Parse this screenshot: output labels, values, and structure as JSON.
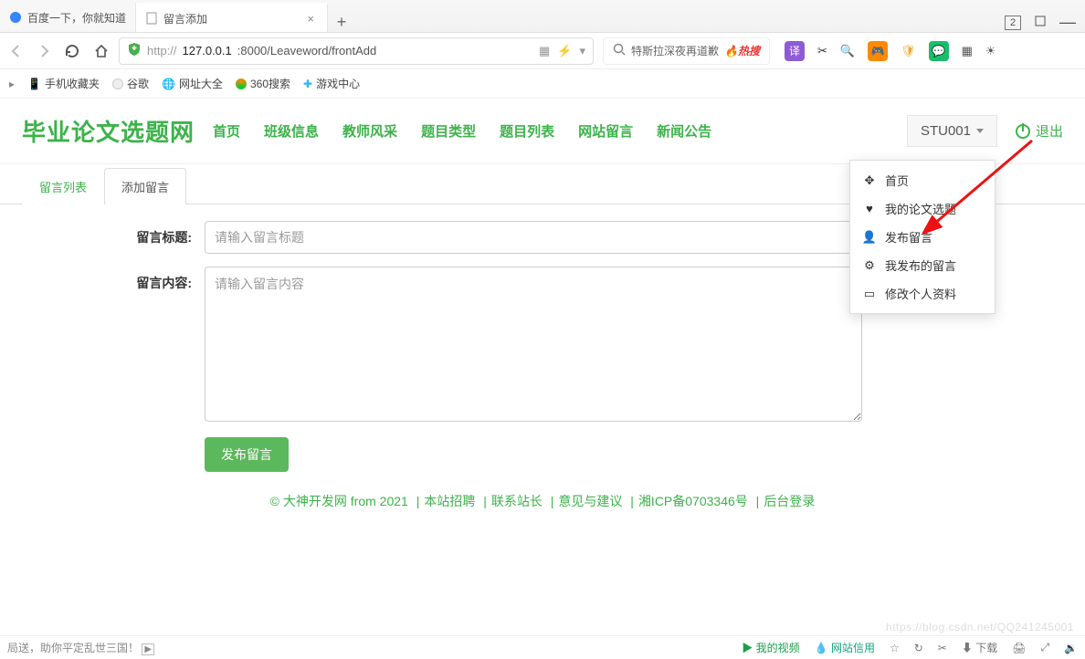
{
  "browser": {
    "tabs": [
      {
        "title": "百度一下，你就知道",
        "favicon_color": "#3385ff"
      },
      {
        "title": "留言添加",
        "favicon_color": "#888"
      }
    ],
    "newtab": "+",
    "window_counter": "2",
    "url_scheme": "http://",
    "url_host": "127.0.0.1",
    "url_port_path": ":8000/Leaveword/frontAdd",
    "hotsearch_text": "特斯拉深夜再道歉",
    "hotsearch_badge": "热搜",
    "bookmarks": [
      "手机收藏夹",
      "谷歌",
      "网址大全",
      "360搜索",
      "游戏中心"
    ]
  },
  "site": {
    "logo": "毕业论文选题网",
    "nav": [
      "首页",
      "班级信息",
      "教师风采",
      "题目类型",
      "题目列表",
      "网站留言",
      "新闻公告"
    ],
    "user": "STU001",
    "logout": "退出",
    "dropdown": [
      "首页",
      "我的论文选题",
      "发布留言",
      "我发布的留言",
      "修改个人资料"
    ]
  },
  "tabs": {
    "list": "留言列表",
    "add": "添加留言"
  },
  "form": {
    "title_label": "留言标题:",
    "title_placeholder": "请输入留言标题",
    "content_label": "留言内容:",
    "content_placeholder": "请输入留言内容",
    "submit": "发布留言"
  },
  "footer": {
    "copyright": "© 大神开发网 from 2021",
    "links": [
      "本站招聘",
      "联系站长",
      "意见与建议",
      "湘ICP备0703346号",
      "后台登录"
    ]
  },
  "status": {
    "promo": "局送，助你平定乱世三国！",
    "video": "我的视频",
    "credit": "网站信用",
    "download": "下载",
    "watermark": "https://blog.csdn.net/QQ241245001"
  }
}
